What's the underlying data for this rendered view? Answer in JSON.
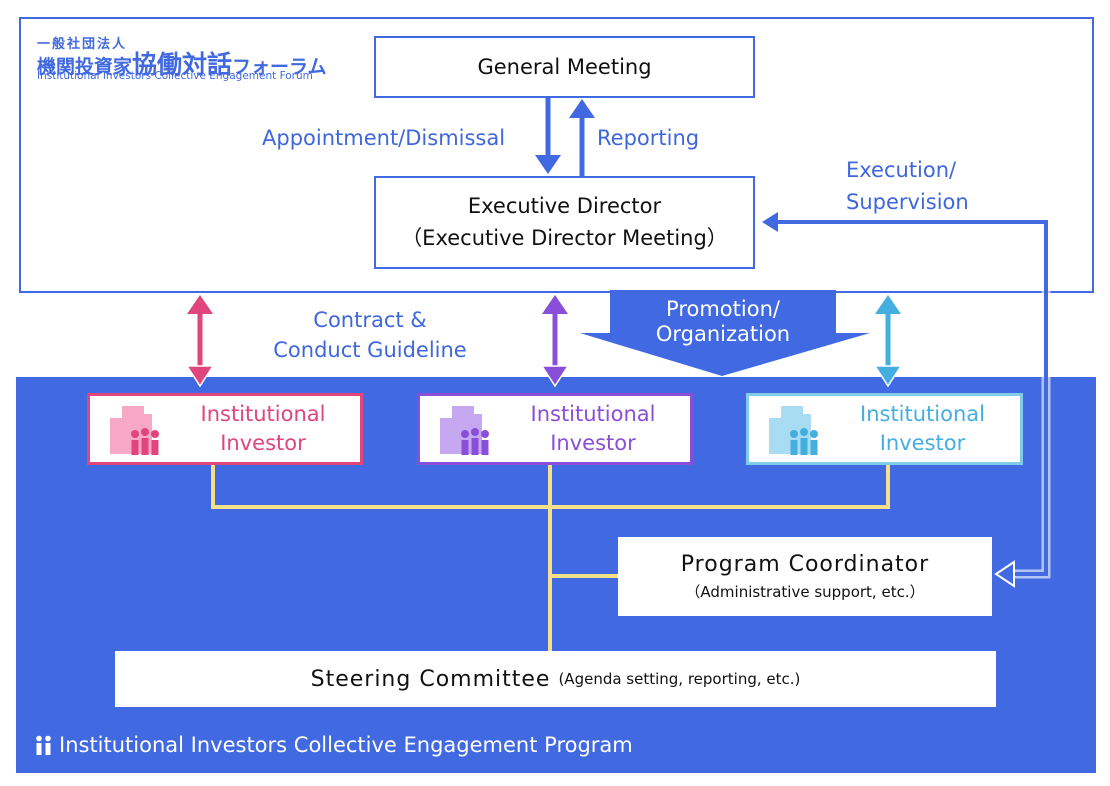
{
  "logo": {
    "jp_small": "一般社団法人",
    "jp_prefix": "機関投資家",
    "jp_main": "協働対話",
    "jp_suffix": "フォーラム",
    "en": "Institutional Investors Collective Engagement Forum"
  },
  "governance": {
    "general_meeting": "General Meeting",
    "executive_director_line1": "Executive Director",
    "executive_director_line2": "（Executive Director Meeting）",
    "appointment_label": "Appointment/Dismissal",
    "reporting_label": "Reporting",
    "execution_label_line1": "Execution/",
    "execution_label_line2": "Supervision"
  },
  "relations": {
    "contract_line1": "Contract &",
    "contract_line2": "Conduct Guideline",
    "promotion_line1": "Promotion/",
    "promotion_line2": "Organization"
  },
  "investors": [
    {
      "line1": "Institutional",
      "line2": "Investor",
      "color": "#e0457b",
      "light": "#f7a8c4"
    },
    {
      "line1": "Institutional",
      "line2": "Investor",
      "color": "#8a4fd8",
      "light": "#c5a8f0"
    },
    {
      "line1": "Institutional",
      "line2": "Investor",
      "color": "#45aee0",
      "light": "#a8dcf2"
    }
  ],
  "program": {
    "coordinator_title": "Program Coordinator",
    "coordinator_sub": "（Administrative support, etc.）",
    "steering_title": "Steering Committee",
    "steering_sub": "(Agenda setting, reporting, etc.)",
    "name": "Institutional Investors Collective Engagement Program"
  },
  "colors": {
    "primary_blue": "#4169e1",
    "connector_yellow": "#f7e08a"
  }
}
